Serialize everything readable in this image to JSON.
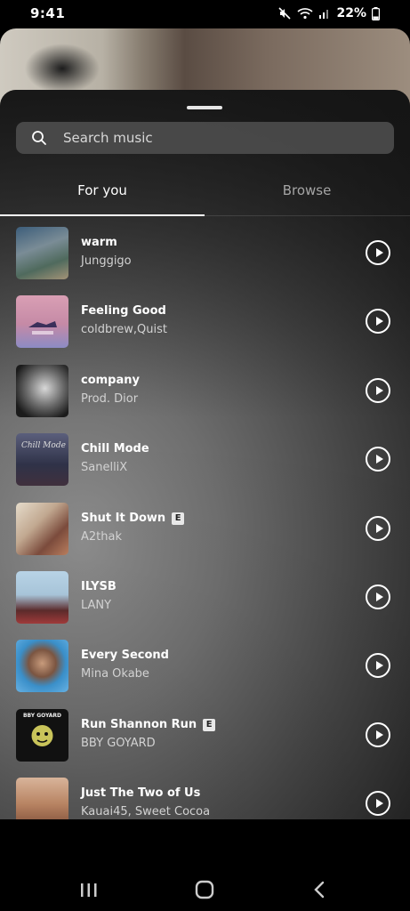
{
  "status_bar": {
    "time": "9:41",
    "battery": "22%"
  },
  "search": {
    "placeholder": "Search music"
  },
  "tabs": [
    {
      "label": "For you",
      "active": true
    },
    {
      "label": "Browse",
      "active": false
    }
  ],
  "tracks": [
    {
      "title": "warm",
      "artist": "Junggigo",
      "explicit": false
    },
    {
      "title": "Feeling Good",
      "artist": "coldbrew,Quist",
      "explicit": false
    },
    {
      "title": "company",
      "artist": "Prod. Dior",
      "explicit": false
    },
    {
      "title": "Chill Mode",
      "artist": "SanelliX",
      "explicit": false
    },
    {
      "title": "Shut It Down",
      "artist": "A2thak",
      "explicit": true
    },
    {
      "title": "ILYSB",
      "artist": "LANY",
      "explicit": false
    },
    {
      "title": "Every Second",
      "artist": "Mina Okabe",
      "explicit": false
    },
    {
      "title": "Run Shannon Run",
      "artist": "BBY GOYARD",
      "explicit": true
    },
    {
      "title": "Just The Two of Us",
      "artist": "Kauai45, Sweet Cocoa",
      "explicit": false
    }
  ],
  "explicit_label": "E",
  "album_art_text": {
    "chill_mode": "Chill Mode",
    "bby_goyard": "BBY GOYARD"
  },
  "colors": {
    "background": "#000000",
    "text": "#ffffff",
    "inactive_tab": "#a5a5a5"
  }
}
